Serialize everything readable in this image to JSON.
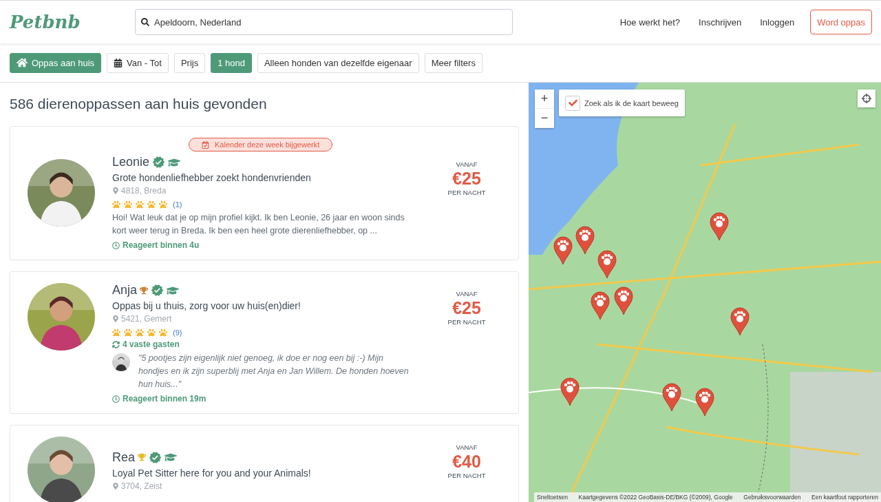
{
  "header": {
    "logo": "Petbnb",
    "search": {
      "value": "Apeldoorn, Nederland"
    },
    "nav": [
      "Hoe werkt het?",
      "Inschrijven",
      "Inloggen"
    ],
    "cta": "Word oppas"
  },
  "filters": [
    {
      "label": "Oppas aan huis",
      "kind": "home",
      "selected": true
    },
    {
      "label": "Van - Tot",
      "kind": "calendar",
      "selected": false
    },
    {
      "label": "Prijs",
      "kind": "plain",
      "selected": false
    },
    {
      "label": "1 hond",
      "kind": "plain",
      "selected": true
    },
    {
      "label": "Alleen honden van dezelfde eigenaar",
      "kind": "plain",
      "selected": false
    },
    {
      "label": "Meer filters",
      "kind": "plain",
      "selected": false
    }
  ],
  "results": {
    "title": "586 dierenoppassen aan huis gevonden",
    "sitters": [
      {
        "notice": "Kalender deze week bijgewerkt",
        "name": "Leonie",
        "badges": [
          {
            "kind": "verified"
          },
          {
            "kind": "graduate"
          }
        ],
        "headline": "Grote hondenliefhebber zoekt hondenvrienden",
        "location": "4818, Breda",
        "stars": 5,
        "reviews": "(1)",
        "description": "Hoi! Wat leuk dat je op mijn profiel kijkt. Ik ben Leonie, 26 jaar en woon sinds kort weer terug in Breda. Ik ben een heel grote dierenliefhebber, op ...",
        "response": "Reageert binnen 4u",
        "price_from": "VANAF",
        "price": "€25",
        "price_unit": "PER NACHT"
      },
      {
        "name": "Anja",
        "badges": [
          {
            "kind": "trophy",
            "color": "#c8863a"
          },
          {
            "kind": "verified"
          },
          {
            "kind": "graduate"
          }
        ],
        "headline": "Oppas bij u thuis, zorg voor uw huis(en)dier!",
        "location": "5421, Gemert",
        "stars": 5,
        "reviews": "(9)",
        "guests": "4 vaste gasten",
        "review": "\"5 pootjes zijn eigenlijk niet genoeg, ik doe er nog een bij :-) Mijn hondjes en ik zijn superblij met Anja en Jan Willem. De honden hoeven hun huis...\"",
        "response": "Reageert binnen 19m",
        "price_from": "VANAF",
        "price": "€25",
        "price_unit": "PER NACHT"
      },
      {
        "name": "Rea",
        "badges": [
          {
            "kind": "trophy",
            "color": "#e8b923"
          },
          {
            "kind": "verified"
          },
          {
            "kind": "graduate"
          }
        ],
        "headline": "Loyal Pet Sitter here for you and your Animals!",
        "location": "3704, Zeist",
        "price_from": "VANAF",
        "price": "€40",
        "price_unit": "PER NACHT"
      }
    ]
  },
  "map": {
    "zoom_in": "+",
    "zoom_out": "−",
    "search_on_move": {
      "label": "Zoek als ik de kaart beweeg",
      "checked": true
    },
    "footer": [
      "Sneltoetsen",
      "Kaartgegevens ©2022 GeoBasis-DE/BKG (©2009), Google",
      "Gebruiksvoorwaarden",
      "Een kaartfout rapporteren"
    ]
  }
}
